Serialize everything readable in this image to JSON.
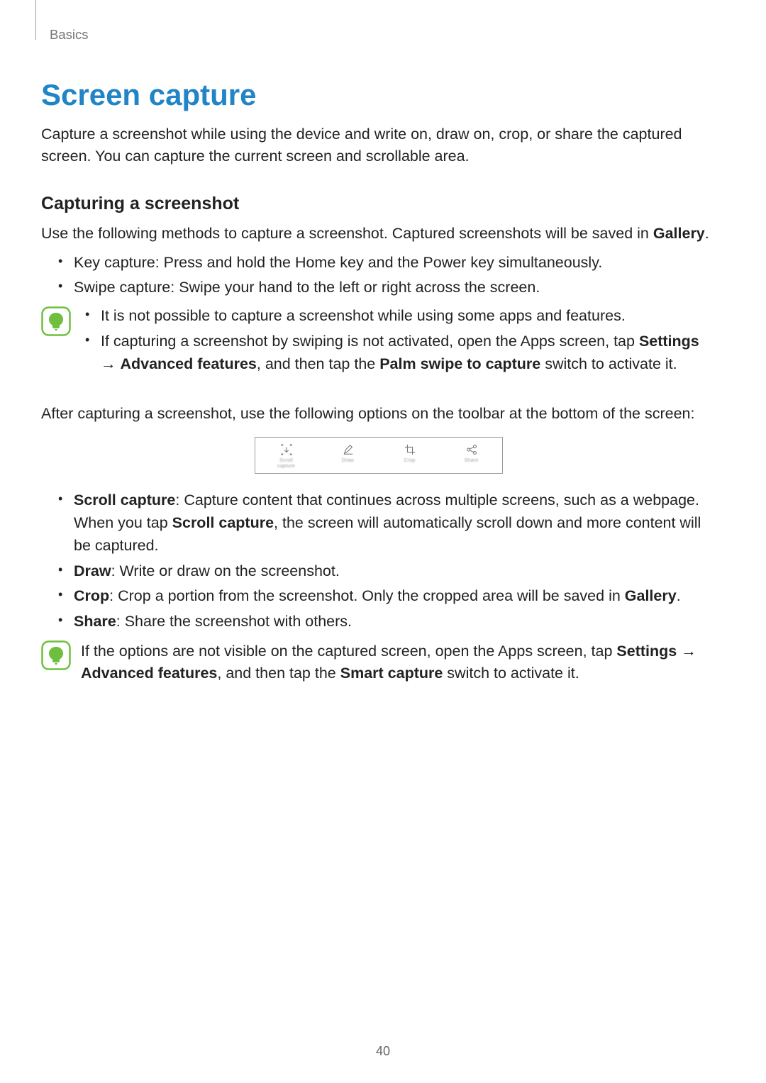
{
  "section_label": "Basics",
  "title": "Screen capture",
  "intro": "Capture a screenshot while using the device and write on, draw on, crop, or share the captured screen. You can capture the current screen and scrollable area.",
  "sub1": {
    "heading": "Capturing a screenshot",
    "lead_pre": "Use the following methods to capture a screenshot. Captured screenshots will be saved in ",
    "lead_bold": "Gallery",
    "lead_post": ".",
    "bullets": [
      "Key capture: Press and hold the Home key and the Power key simultaneously.",
      "Swipe capture: Swipe your hand to the left or right across the screen."
    ]
  },
  "note1": {
    "b1": "It is not possible to capture a screenshot while using some apps and features.",
    "b2_pre": "If capturing a screenshot by swiping is not activated, open the Apps screen, tap ",
    "b2_settings": "Settings",
    "b2_arrow": " → ",
    "b2_adv": "Advanced features",
    "b2_mid": ", and then tap the ",
    "b2_palm": "Palm swipe to capture",
    "b2_post": " switch to activate it."
  },
  "after_text": "After capturing a screenshot, use the following options on the toolbar at the bottom of the screen:",
  "toolbar": [
    {
      "icon": "scroll-capture-icon",
      "label": "Scroll",
      "label2": "capture"
    },
    {
      "icon": "draw-icon",
      "label": "Draw",
      "label2": ""
    },
    {
      "icon": "crop-icon",
      "label": "Crop",
      "label2": ""
    },
    {
      "icon": "share-icon",
      "label": "Share",
      "label2": ""
    }
  ],
  "options": {
    "scroll": {
      "name": "Scroll capture",
      "pre": ": Capture content that continues across multiple screens, such as a webpage. When you tap ",
      "mid_bold": "Scroll capture",
      "post": ", the screen will automatically scroll down and more content will be captured."
    },
    "draw": {
      "name": "Draw",
      "text": ": Write or draw on the screenshot."
    },
    "crop": {
      "name": "Crop",
      "pre": ": Crop a portion from the screenshot. Only the cropped area will be saved in ",
      "gallery": "Gallery",
      "post": "."
    },
    "share": {
      "name": "Share",
      "text": ": Share the screenshot with others."
    }
  },
  "note2": {
    "pre": "If the options are not visible on the captured screen, open the Apps screen, tap ",
    "settings": "Settings",
    "arrow": " → ",
    "adv": "Advanced features",
    "mid": ", and then tap the ",
    "smart": "Smart capture",
    "post": " switch to activate it."
  },
  "page_number": "40"
}
